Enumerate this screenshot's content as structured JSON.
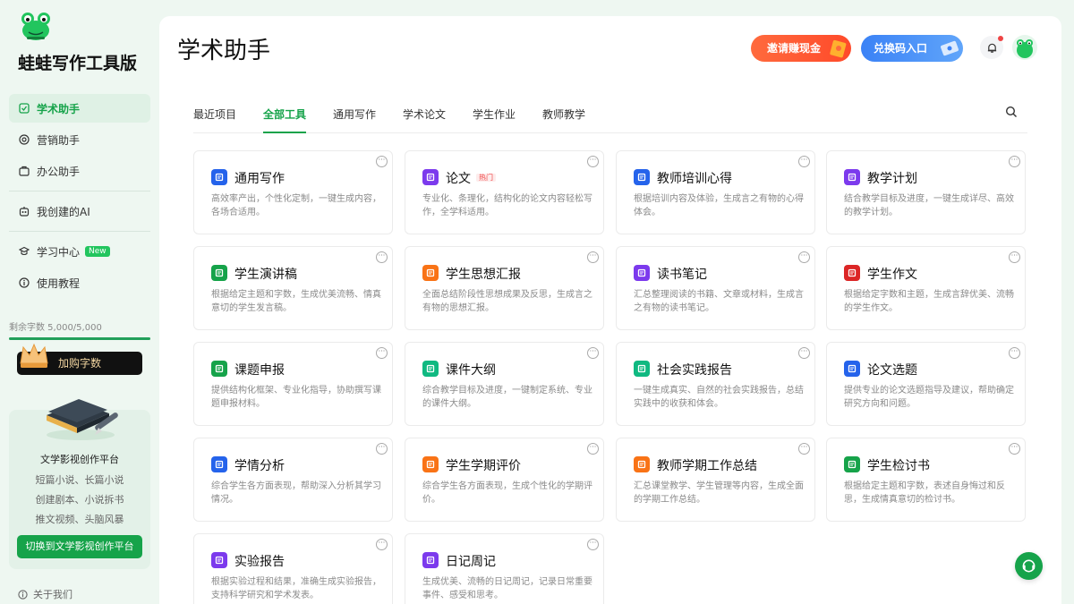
{
  "app": {
    "title": "蛙蛙写作工具版"
  },
  "sidebar": {
    "items": [
      {
        "label": "学术助手",
        "icon": "academic-icon"
      },
      {
        "label": "营销助手",
        "icon": "marketing-icon"
      },
      {
        "label": "办公助手",
        "icon": "office-icon"
      },
      {
        "label": "我创建的AI",
        "icon": "my-ai-icon"
      },
      {
        "label": "学习中心",
        "icon": "learn-icon",
        "badge": "New"
      },
      {
        "label": "使用教程",
        "icon": "tutorial-icon"
      }
    ],
    "quota_text": "剩余字数 5,000/5,000",
    "quota_fraction": 1.0,
    "buy_button": "加购字数",
    "promo": {
      "title": "文学影视创作平台",
      "lines": [
        "短篇小说、长篇小说",
        "创建剧本、小说拆书",
        "推文视频、头脑风暴"
      ],
      "button": "切换到文学影视创作平台"
    },
    "about": "关于我们"
  },
  "header": {
    "page_title": "学术助手",
    "invite_button": "邀请赚现金",
    "redeem_button": "兑换码入口",
    "accent_color": "#16a34a"
  },
  "tabs": [
    "最近项目",
    "全部工具",
    "通用写作",
    "学术论文",
    "学生作业",
    "教师教学"
  ],
  "active_tab": "全部工具",
  "cards": [
    {
      "title": "通用写作",
      "desc": "高效率产出，个性化定制，一键生成内容，各场合适用。",
      "icon": "pen-icon",
      "color": "#2563eb"
    },
    {
      "title": "论文",
      "tag": "热门",
      "desc": "专业化、条理化，结构化的论文内容轻松写作，全学科适用。",
      "icon": "paper-icon",
      "color": "#7c3aed"
    },
    {
      "title": "教师培训心得",
      "desc": "根据培训内容及体验，生成言之有物的心得体会。",
      "icon": "teacher-icon",
      "color": "#2563eb"
    },
    {
      "title": "教学计划",
      "desc": "结合教学目标及进度，一键生成详尽、高效的教学计划。",
      "icon": "plan-icon",
      "color": "#7c3aed"
    },
    {
      "title": "学生演讲稿",
      "desc": "根据给定主题和字数，生成优美流畅、情真意切的学生发言稿。",
      "icon": "speech-icon",
      "color": "#16a34a"
    },
    {
      "title": "学生思想汇报",
      "desc": "全面总结阶段性思想成果及反思，生成言之有物的思想汇报。",
      "icon": "report-icon",
      "color": "#f97316"
    },
    {
      "title": "读书笔记",
      "desc": "汇总整理阅读的书籍、文章或材料，生成言之有物的读书笔记。",
      "icon": "book-icon",
      "color": "#7c3aed"
    },
    {
      "title": "学生作文",
      "desc": "根据给定字数和主题，生成言辞优美、流畅的学生作文。",
      "icon": "essay-icon",
      "color": "#dc2626"
    },
    {
      "title": "课题申报",
      "desc": "提供结构化框架、专业化指导，协助撰写课题申报材料。",
      "icon": "project-icon",
      "color": "#16a34a"
    },
    {
      "title": "课件大纲",
      "desc": "综合教学目标及进度，一键制定系统、专业的课件大纲。",
      "icon": "outline-icon",
      "color": "#10b981"
    },
    {
      "title": "社会实践报告",
      "desc": "一键生成真实、自然的社会实践报告，总结实践中的收获和体会。",
      "icon": "practice-icon",
      "color": "#10b981"
    },
    {
      "title": "论文选题",
      "desc": "提供专业的论文选题指导及建议，帮助确定研究方向和问题。",
      "icon": "topic-icon",
      "color": "#2563eb"
    },
    {
      "title": "学情分析",
      "desc": "综合学生各方面表现，帮助深入分析其学习情况。",
      "icon": "analysis-icon",
      "color": "#2563eb"
    },
    {
      "title": "学生学期评价",
      "desc": "综合学生各方面表现，生成个性化的学期评价。",
      "icon": "evaluation-icon",
      "color": "#f97316"
    },
    {
      "title": "教师学期工作总结",
      "desc": "汇总课堂教学、学生管理等内容，生成全面的学期工作总结。",
      "icon": "summary-icon",
      "color": "#f97316"
    },
    {
      "title": "学生检讨书",
      "desc": "根据给定主题和字数，表述自身悔过和反思，生成情真意切的检讨书。",
      "icon": "review-icon",
      "color": "#16a34a"
    },
    {
      "title": "实验报告",
      "desc": "根据实验过程和结果，准确生成实验报告，支持科学研究和学术发表。",
      "icon": "experiment-icon",
      "color": "#7c3aed"
    },
    {
      "title": "日记周记",
      "desc": "生成优美、流畅的日记周记，记录日常重要事件、感受和思考。",
      "icon": "diary-icon",
      "color": "#7c3aed"
    }
  ]
}
